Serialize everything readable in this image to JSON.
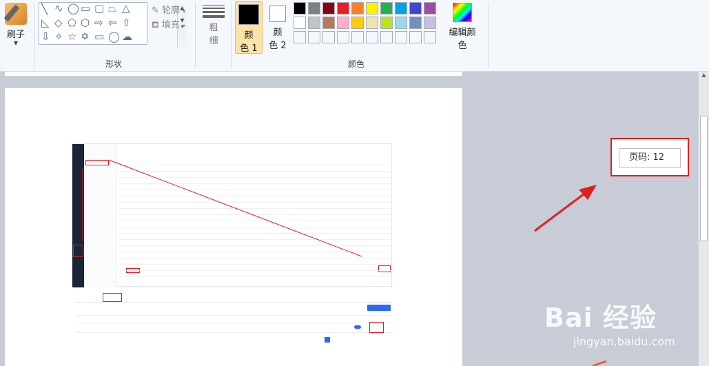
{
  "ribbon": {
    "brush_label": "刷子",
    "outline_label": "轮廓",
    "fill_label": "填充",
    "shapes_group": "形状",
    "thickness_label_1": "粗",
    "thickness_label_2": "细",
    "color1_line1": "颜",
    "color1_line2": "色 1",
    "color2_line1": "颜",
    "color2_line2": "色 2",
    "colors_group": "颜色",
    "edit_colors": "编辑颜色",
    "color1_value": "#000000",
    "color2_value": "#ffffff",
    "palette_row1": [
      "#000000",
      "#7f7f7f",
      "#880015",
      "#ed1c24",
      "#ff7f27",
      "#fff200",
      "#22b14c",
      "#00a2e8",
      "#3f48cc",
      "#a349a4"
    ],
    "palette_row2": [
      "#ffffff",
      "#c3c3c3",
      "#b97a57",
      "#ffaec9",
      "#ffc90e",
      "#efe4b0",
      "#b5e61d",
      "#99d9ea",
      "#7092be",
      "#c8bfe7"
    ]
  },
  "canvas": {
    "page_label": "页码: 12"
  },
  "watermark": {
    "logo_text": "Bai 经验",
    "site": "jingyan.baidu.com"
  }
}
